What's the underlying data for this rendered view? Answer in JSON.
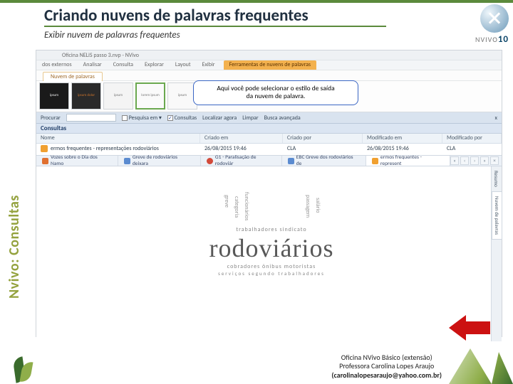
{
  "slide": {
    "title": "Criando nuvens de palavras frequentes",
    "subtitle": "Exibir nuvem de palavras frequentes",
    "sidebar_label": "Nvivo: Consultas"
  },
  "logo": {
    "brand": "NVIVO",
    "version": "10"
  },
  "callout": {
    "line1": "Aqui você pode selecionar o estilo de saída",
    "line2": "da nuvem de palavra."
  },
  "window": {
    "title": "Oficina NELiS passo 3.nvp - NVivo"
  },
  "ribbon": {
    "tabs": [
      "dos externos",
      "Analisar",
      "Consulta",
      "Explorar",
      "Layout",
      "Exibir"
    ],
    "highlight_tab": "Ferramentas de nuvens de palavras",
    "sub_tab": "Nuvem de palavras"
  },
  "style_gallery": {
    "thumbs": [
      "ipsum",
      "ipsum dolor",
      "ipsum",
      "lorem ipsum",
      "ipsum"
    ]
  },
  "find_bar": {
    "label": "Procurar",
    "opt_pesquisa": "Pesquisa em",
    "opt_consultas": "Consultas",
    "opt_localizar": "Localizar agora",
    "opt_limpar": "Limpar",
    "opt_busca": "Busca avançada",
    "close": "x"
  },
  "queries": {
    "header": "Consultas",
    "cols": {
      "name": "Nome",
      "created": "Criado em",
      "created_by": "Criado por",
      "modified": "Modificado em",
      "modified_by": "Modificado por"
    },
    "row": {
      "name": "ermos frequentes - representações rodoviários",
      "created": "26/08/2015 19:46",
      "created_by": "CLA",
      "modified": "26/08/2015 19:46",
      "modified_by": "CLA"
    }
  },
  "doc_tabs": {
    "t1": "Vozes sobre o Dia dos Namo",
    "t2": "Greve de rodoviários deixara",
    "t3": "G1 - Paralisação de rodoviár",
    "t4": "EBC Greve dos rodoviários de",
    "t5": "ermos frequentes - represent"
  },
  "side_tabs": {
    "a": "Resumo",
    "b": "Nuvem de palavras"
  },
  "wordcloud": {
    "main": "rodoviários",
    "row_above": "trabalhadores sindicato",
    "row_below": "cobradores ônibus motoristas"
  },
  "footer": {
    "line1": "Oficina NVivo Básico (extensão)",
    "line2": "Professora Carolina Lopes Araujo",
    "line3": "(carolinalopesaraujo@yahoo.com.br)"
  }
}
